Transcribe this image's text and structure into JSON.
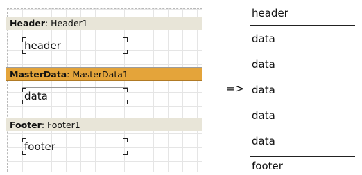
{
  "designer": {
    "bands": [
      {
        "type_label": "Header",
        "name_label": ": Header1",
        "object_text": "header"
      },
      {
        "type_label": "MasterData",
        "name_label": ": MasterData1",
        "object_text": "data"
      },
      {
        "type_label": "Footer",
        "name_label": ": Footer1",
        "object_text": "footer"
      }
    ]
  },
  "arrow": "=>",
  "preview": {
    "header": "header",
    "rows": [
      "data",
      "data",
      "data",
      "data",
      "data"
    ],
    "footer": "footer"
  },
  "colors": {
    "band_header": "#e8e5d8",
    "band_master": "#e4a43a",
    "band_footer": "#e8e5d8"
  }
}
